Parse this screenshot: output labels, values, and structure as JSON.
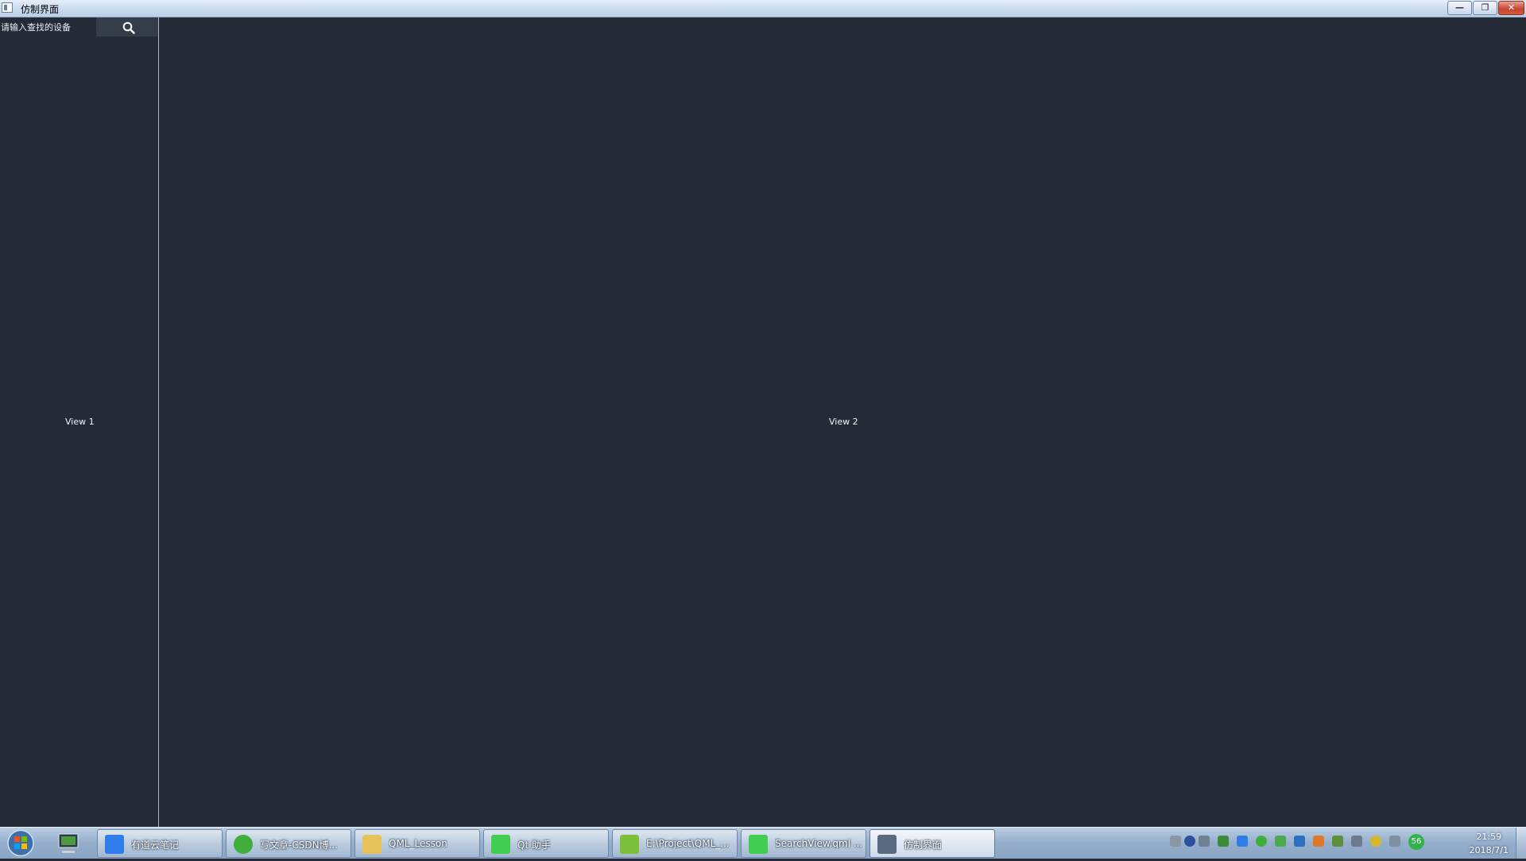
{
  "window": {
    "title": "仿制界面",
    "controls": [
      "minimize",
      "restore",
      "close"
    ]
  },
  "left_panel": {
    "search": {
      "placeholder": "请输入查找的设备",
      "value": ""
    },
    "label": "View 1"
  },
  "right_panel": {
    "label": "View 2"
  },
  "taskbar": {
    "tasks": [
      {
        "label": "有道云笔记",
        "icon": "youdao-note-icon",
        "color": "#2f7de8"
      },
      {
        "label": "写文章-CSDN博...",
        "icon": "browser-icon",
        "color": "#3fae3a"
      },
      {
        "label": "QML_Lesson",
        "icon": "folder-icon",
        "color": "#e6c25a"
      },
      {
        "label": "Qt 助手",
        "icon": "qt-icon",
        "color": "#41cd52"
      },
      {
        "label": "E:\\Project\\QML_...",
        "icon": "notepad-icon",
        "color": "#7bbf3a"
      },
      {
        "label": "SearchView.qml ...",
        "icon": "qt-creator-icon",
        "color": "#41cd52"
      },
      {
        "label": "仿制界面",
        "icon": "app-window-icon",
        "color": "#5a6a80"
      }
    ],
    "tray_badge": "56",
    "clock": {
      "time": "21:59",
      "date": "2018/7/1"
    }
  },
  "colors": {
    "background": "#252b36",
    "search_button": "#353d4a",
    "divider": "#aab4c2"
  }
}
